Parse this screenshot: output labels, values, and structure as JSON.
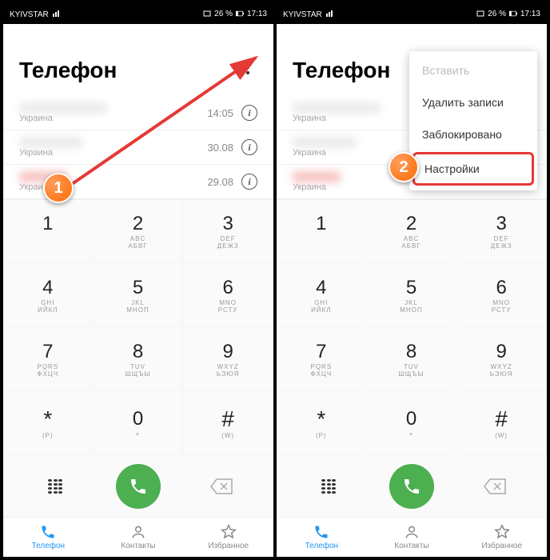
{
  "status": {
    "carrier": "KYIVSTAR",
    "battery": "26 %",
    "time": "17:13"
  },
  "header": {
    "title": "Телефон"
  },
  "calls": [
    {
      "sub": "Украина",
      "time": "14:05"
    },
    {
      "sub": "Украина",
      "time": "30.08"
    },
    {
      "sub": "Украина",
      "time": "29.08"
    }
  ],
  "keys": {
    "k1n": "1",
    "k1a": "",
    "k1b": "",
    "k2n": "2",
    "k2a": "ABC",
    "k2b": "АБВГ",
    "k3n": "3",
    "k3a": "DEF",
    "k3b": "ДЕЖЗ",
    "k4n": "4",
    "k4a": "GHI",
    "k4b": "ИЙКЛ",
    "k5n": "5",
    "k5a": "JKL",
    "k5b": "МНОП",
    "k6n": "6",
    "k6a": "MNO",
    "k6b": "РСТУ",
    "k7n": "7",
    "k7a": "PQRS",
    "k7b": "ФХЦЧ",
    "k8n": "8",
    "k8a": "TUV",
    "k8b": "ШЩЪЫ",
    "k9n": "9",
    "k9a": "WXYZ",
    "k9b": "ЬЭЮЯ",
    "kStarN": "*",
    "kStarA": "(P)",
    "k0n": "0",
    "k0a": "+",
    "kHashN": "#",
    "kHashA": "(W)"
  },
  "nav": {
    "phone": "Телефон",
    "contacts": "Контакты",
    "fav": "Избранное"
  },
  "popup": {
    "paste": "Вставить",
    "delete": "Удалить записи",
    "blocked": "Заблокировано",
    "settings": "Настройки"
  },
  "markers": {
    "m1": "1",
    "m2": "2"
  }
}
